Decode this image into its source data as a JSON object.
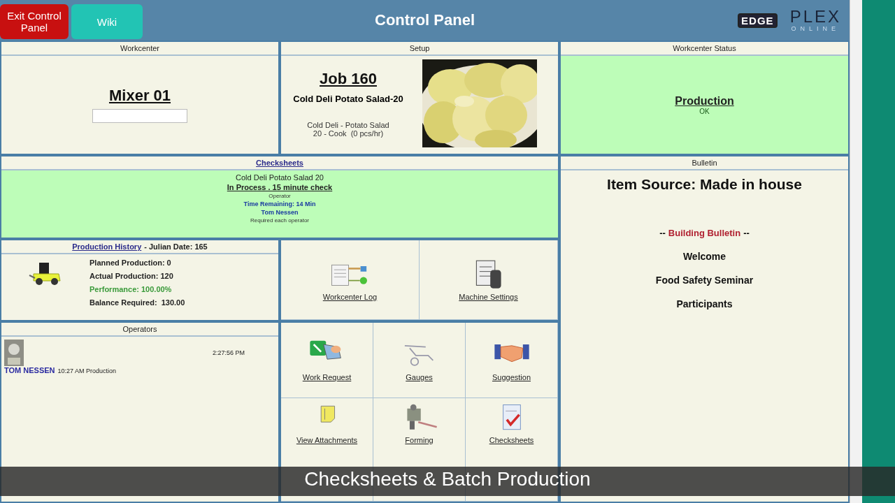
{
  "header": {
    "buttons": [
      {
        "label": "Exit Control Panel",
        "kind": "exit"
      },
      {
        "label": "Wiki",
        "kind": "wiki"
      }
    ],
    "title": "Control Panel",
    "logo_edge": "EDGE",
    "logo_plex": "PLEX",
    "logo_sub": "ONLINE"
  },
  "workcenter": {
    "heading": "Workcenter",
    "name": "Mixer 01"
  },
  "setup": {
    "heading": "Setup",
    "job": "Job 160",
    "part": "Cold Deli Potato Salad-20",
    "description_lines": [
      "Cold Deli - Potato Salad",
      "20 - Cook  (0 pcs/hr)"
    ]
  },
  "status": {
    "heading": "Workcenter Status",
    "state": "Production",
    "detail": "OK"
  },
  "checksheets": {
    "heading": "Checksheets",
    "lines": [
      {
        "text": "Cold Deli Potato Salad 20",
        "kind": "plain"
      },
      {
        "text": "In Process . 15 minute check",
        "kind": "link"
      },
      {
        "text": "Operator",
        "kind": "small"
      },
      {
        "text": "Time Remaining: 14 Min",
        "kind": "blue"
      },
      {
        "text": "Tom Nessen",
        "kind": "blue"
      },
      {
        "text": "Required each operator",
        "kind": "small"
      }
    ]
  },
  "production_history": {
    "link": "Production History",
    "suffix": "- Julian Date: 165",
    "stats": [
      {
        "text": "Planned Production: 0",
        "kind": "plain"
      },
      {
        "text": "Actual Production: 120",
        "kind": "plain"
      },
      {
        "text": "Performance: 100.00%",
        "kind": "good"
      },
      {
        "text": "Balance Required:  130.00",
        "kind": "plain"
      }
    ]
  },
  "operators": {
    "heading": "Operators",
    "time": "2:27:56 PM",
    "entries": [
      {
        "name": "TOM NESSEN",
        "detail": "10:27 AM Production"
      }
    ]
  },
  "tools_top": [
    {
      "label": "Workcenter Log",
      "kind": "log"
    },
    {
      "label": "Machine Settings",
      "kind": "settings"
    }
  ],
  "tools_bottom": [
    {
      "label": "Work Request",
      "kind": "request"
    },
    {
      "label": "Gauges",
      "kind": "gauge"
    },
    {
      "label": "Suggestion",
      "kind": "handshake"
    },
    {
      "label": "View Attachments",
      "kind": "attach"
    },
    {
      "label": "Forming",
      "kind": "machine"
    },
    {
      "label": "Checksheets",
      "kind": "check"
    }
  ],
  "bulletin": {
    "heading": "Bulletin",
    "source": "Item Source: Made in house",
    "banner_prefix": "--",
    "banner": "Building Bulletin",
    "banner_suffix": "--",
    "items": [
      "Welcome",
      "Food Safety Seminar",
      "Participants"
    ]
  },
  "caption": "Checksheets & Batch Production"
}
